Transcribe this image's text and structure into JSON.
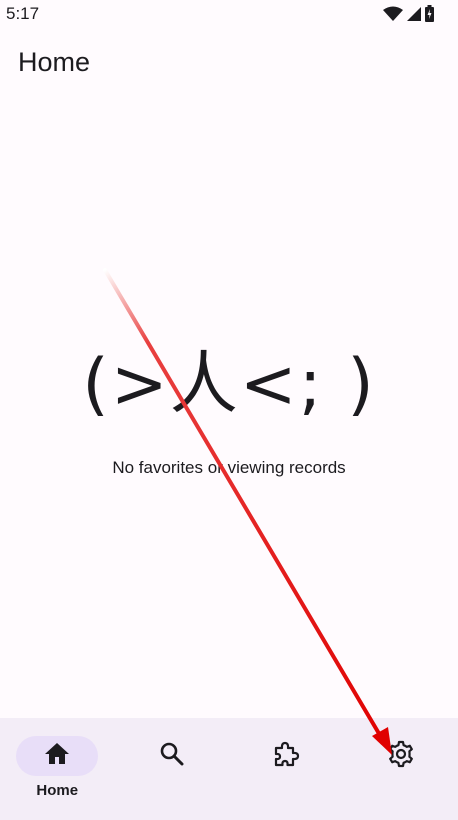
{
  "status_bar": {
    "time": "5:17",
    "icons": [
      "wifi-icon",
      "cellular-signal-icon",
      "battery-charging-icon"
    ]
  },
  "app_bar": {
    "title": "Home"
  },
  "empty_state": {
    "emoticon": "(>人<; )",
    "message": "No favorites or viewing records"
  },
  "bottom_nav": {
    "items": [
      {
        "label": "Home",
        "icon": "home-icon",
        "active": true
      },
      {
        "label": "",
        "icon": "search-icon",
        "active": false
      },
      {
        "label": "",
        "icon": "extension-puzzle-icon",
        "active": false
      },
      {
        "label": "",
        "icon": "settings-gear-icon",
        "active": false
      }
    ]
  },
  "colors": {
    "background": "#fffbfe",
    "nav_background": "#f3edf7",
    "nav_indicator": "#e8def8",
    "text": "#1c1b1f",
    "annotation_arrow": "#e00000"
  }
}
